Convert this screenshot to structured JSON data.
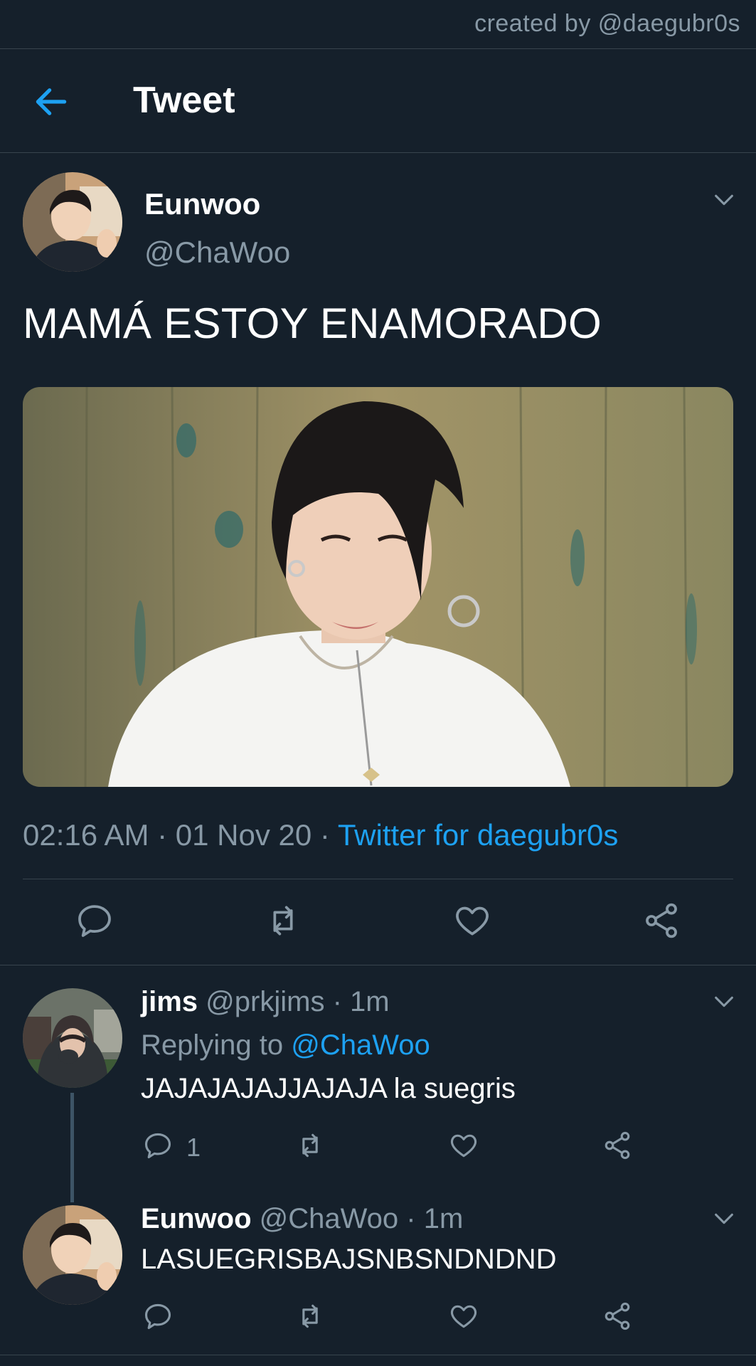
{
  "watermark": "created by @daegubr0s",
  "header": {
    "title": "Tweet"
  },
  "tweet": {
    "display_name": "Eunwoo",
    "handle": "@ChaWoo",
    "text": "MAMÁ ESTOY ENAMORADO",
    "time": "02:16 AM",
    "date": "01 Nov 20",
    "separator": " · ",
    "source": "Twitter for daegubr0s"
  },
  "replies": [
    {
      "display_name": "jims",
      "handle": "@prkjims",
      "age": "1m",
      "replying_label": "Replying to",
      "replying_handle": "@ChaWoo",
      "text": "JAJAJAJAJJAJAJA la suegris",
      "reply_count": "1"
    },
    {
      "display_name": "Eunwoo",
      "handle": "@ChaWoo",
      "age": "1m",
      "text": "LASUEGRISBAJSNBSNDNDND"
    }
  ],
  "icons": {
    "back": "arrow-left-icon",
    "chevron": "chevron-down-icon",
    "reply": "comment-icon",
    "retweet": "retweet-icon",
    "like": "heart-icon",
    "share": "share-icon"
  },
  "colors": {
    "background": "#15202b",
    "accent": "#1da1f2",
    "muted": "#8899a6",
    "divider": "#38444d"
  }
}
